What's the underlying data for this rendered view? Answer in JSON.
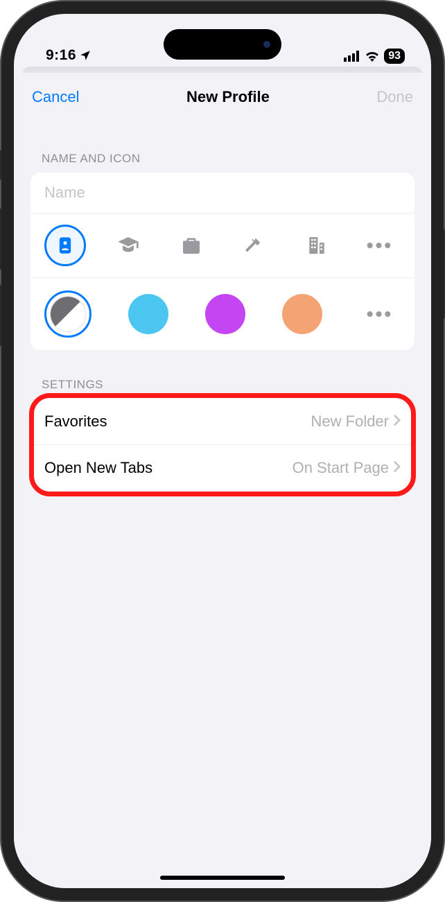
{
  "status": {
    "time": "9:16",
    "battery": "93"
  },
  "nav": {
    "cancel": "Cancel",
    "title": "New Profile",
    "done": "Done"
  },
  "sections": {
    "name_icon": "NAME AND ICON",
    "settings": "SETTINGS"
  },
  "name_field": {
    "placeholder": "Name"
  },
  "icons": [
    {
      "id": "profile-card-icon",
      "selected": true
    },
    {
      "id": "graduation-cap-icon",
      "selected": false
    },
    {
      "id": "briefcase-icon",
      "selected": false
    },
    {
      "id": "hammer-icon",
      "selected": false
    },
    {
      "id": "building-icon",
      "selected": false
    },
    {
      "id": "more-icon",
      "selected": false
    }
  ],
  "colors": [
    {
      "id": "bw-split",
      "hex": "split",
      "selected": true
    },
    {
      "id": "blue",
      "hex": "#4bc6f0",
      "selected": false
    },
    {
      "id": "purple",
      "hex": "#c445f2",
      "selected": false
    },
    {
      "id": "orange",
      "hex": "#f4a375",
      "selected": false
    },
    {
      "id": "more",
      "hex": "more",
      "selected": false
    }
  ],
  "settings": {
    "favorites": {
      "label": "Favorites",
      "value": "New Folder"
    },
    "open_new_tabs": {
      "label": "Open New Tabs",
      "value": "On Start Page"
    }
  }
}
